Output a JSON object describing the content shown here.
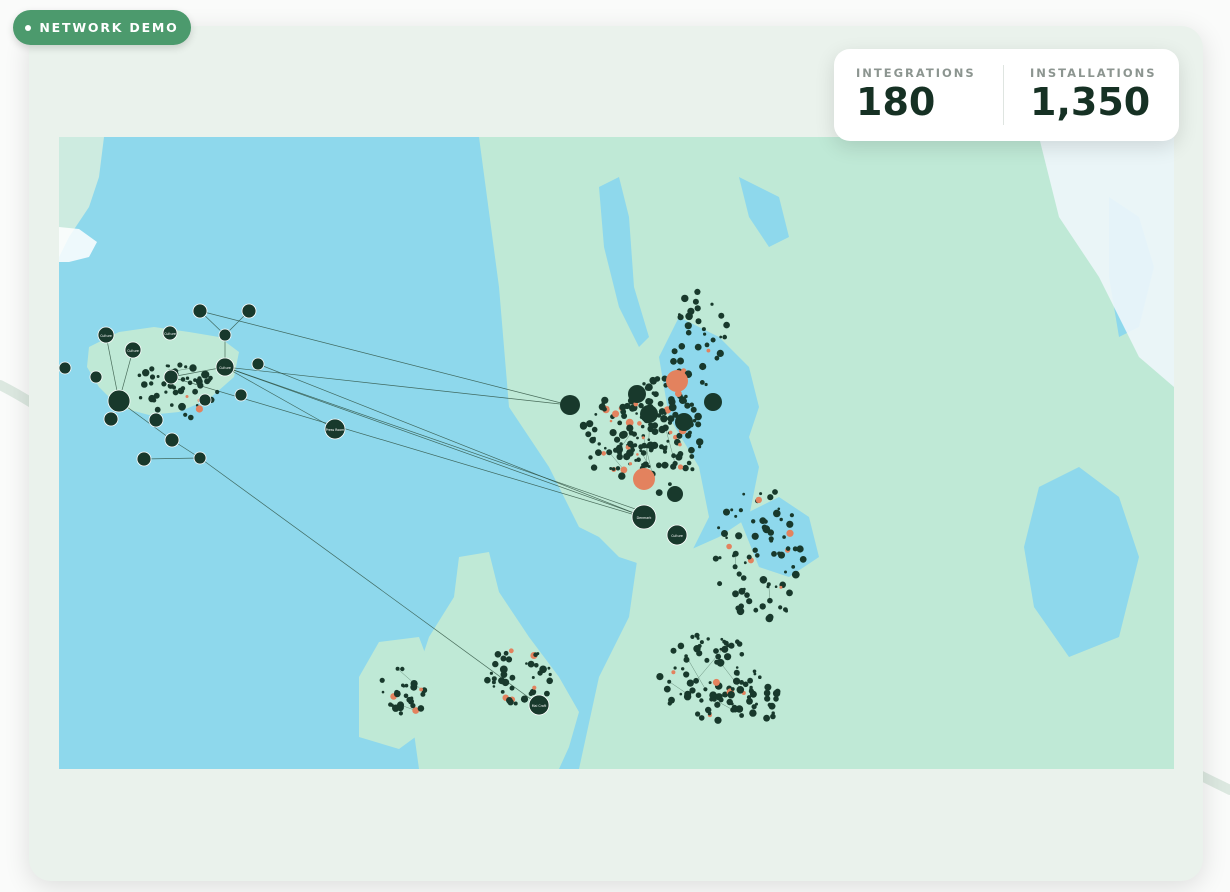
{
  "badge": {
    "label": "NETWORK DEMO"
  },
  "stats": [
    {
      "label": "INTEGRATIONS",
      "value": "180"
    },
    {
      "label": "INSTALLATIONS",
      "value": "1,350"
    }
  ],
  "map": {
    "colors": {
      "sea": "#8ed8ec",
      "land": "#bfe9d6",
      "node": "#18392c",
      "highlight": "#e3825e",
      "line": "#2b4d3c"
    },
    "hubs": [
      {
        "label": "Culture"
      },
      {
        "label": "Culture"
      },
      {
        "label": "Culture"
      },
      {
        "label": "Culture"
      },
      {
        "label": "Press Room"
      },
      {
        "label": "Denmark"
      },
      {
        "label": "Culture"
      },
      {
        "label": "Mai Craft"
      }
    ]
  }
}
